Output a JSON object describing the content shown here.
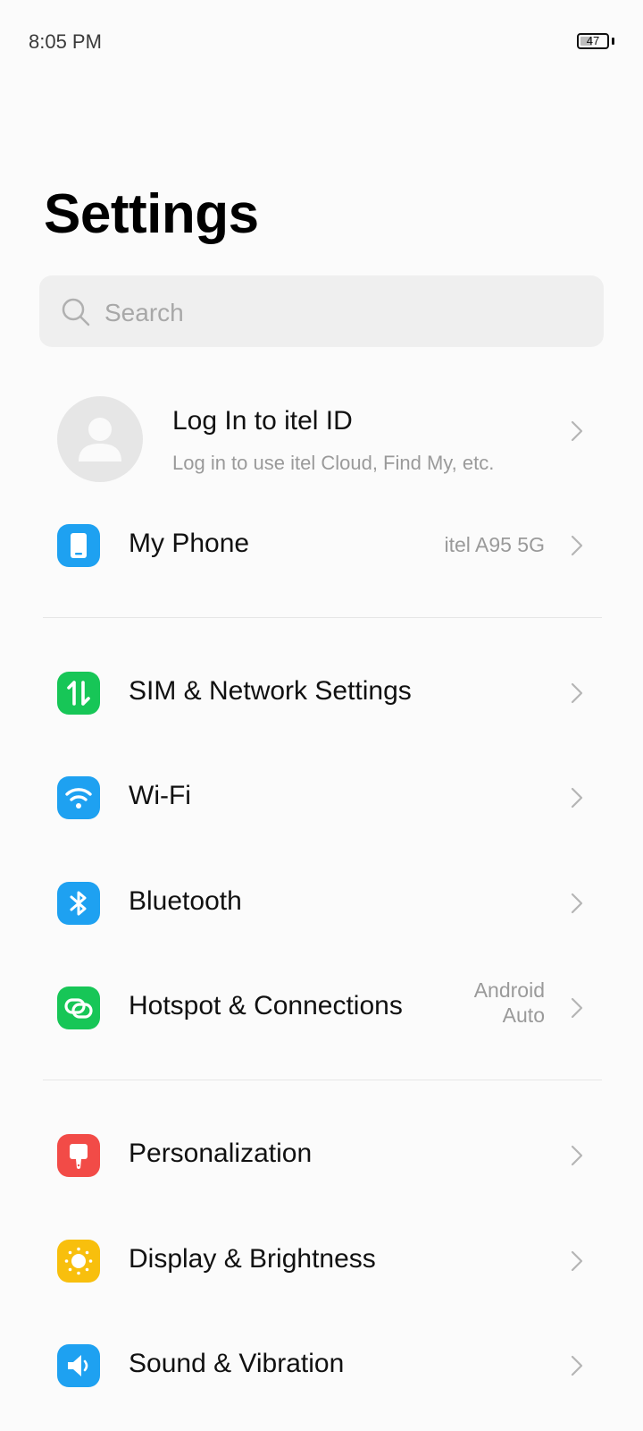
{
  "status": {
    "time": "8:05 PM",
    "battery": "47",
    "battery_level": 0.47
  },
  "page": {
    "title": "Settings"
  },
  "search": {
    "placeholder": "Search"
  },
  "account": {
    "title": "Log In to itel ID",
    "subtitle": "Log in to use itel Cloud, Find My, etc."
  },
  "rows": [
    {
      "label": "My Phone",
      "value": "itel A95 5G",
      "icon": "phone-icon",
      "color": "#1ea1f1"
    },
    {
      "label": "SIM & Network Settings",
      "value": "",
      "icon": "sim-network-icon",
      "color": "#17c657"
    },
    {
      "label": "Wi-Fi",
      "value": "",
      "icon": "wifi-icon",
      "color": "#1ea1f1"
    },
    {
      "label": "Bluetooth",
      "value": "",
      "icon": "bluetooth-icon",
      "color": "#1ea1f1"
    },
    {
      "label": "Hotspot & Connections",
      "value_line1": "Android",
      "value_line2": "Auto",
      "icon": "hotspot-icon",
      "color": "#17c657"
    },
    {
      "label": "Personalization",
      "value": "",
      "icon": "brush-icon",
      "color": "#f24b47"
    },
    {
      "label": "Display & Brightness",
      "value": "",
      "icon": "sun-icon",
      "color": "#f8bf0d"
    },
    {
      "label": "Sound & Vibration",
      "value": "",
      "icon": "speaker-icon",
      "color": "#1ea1f1"
    }
  ]
}
